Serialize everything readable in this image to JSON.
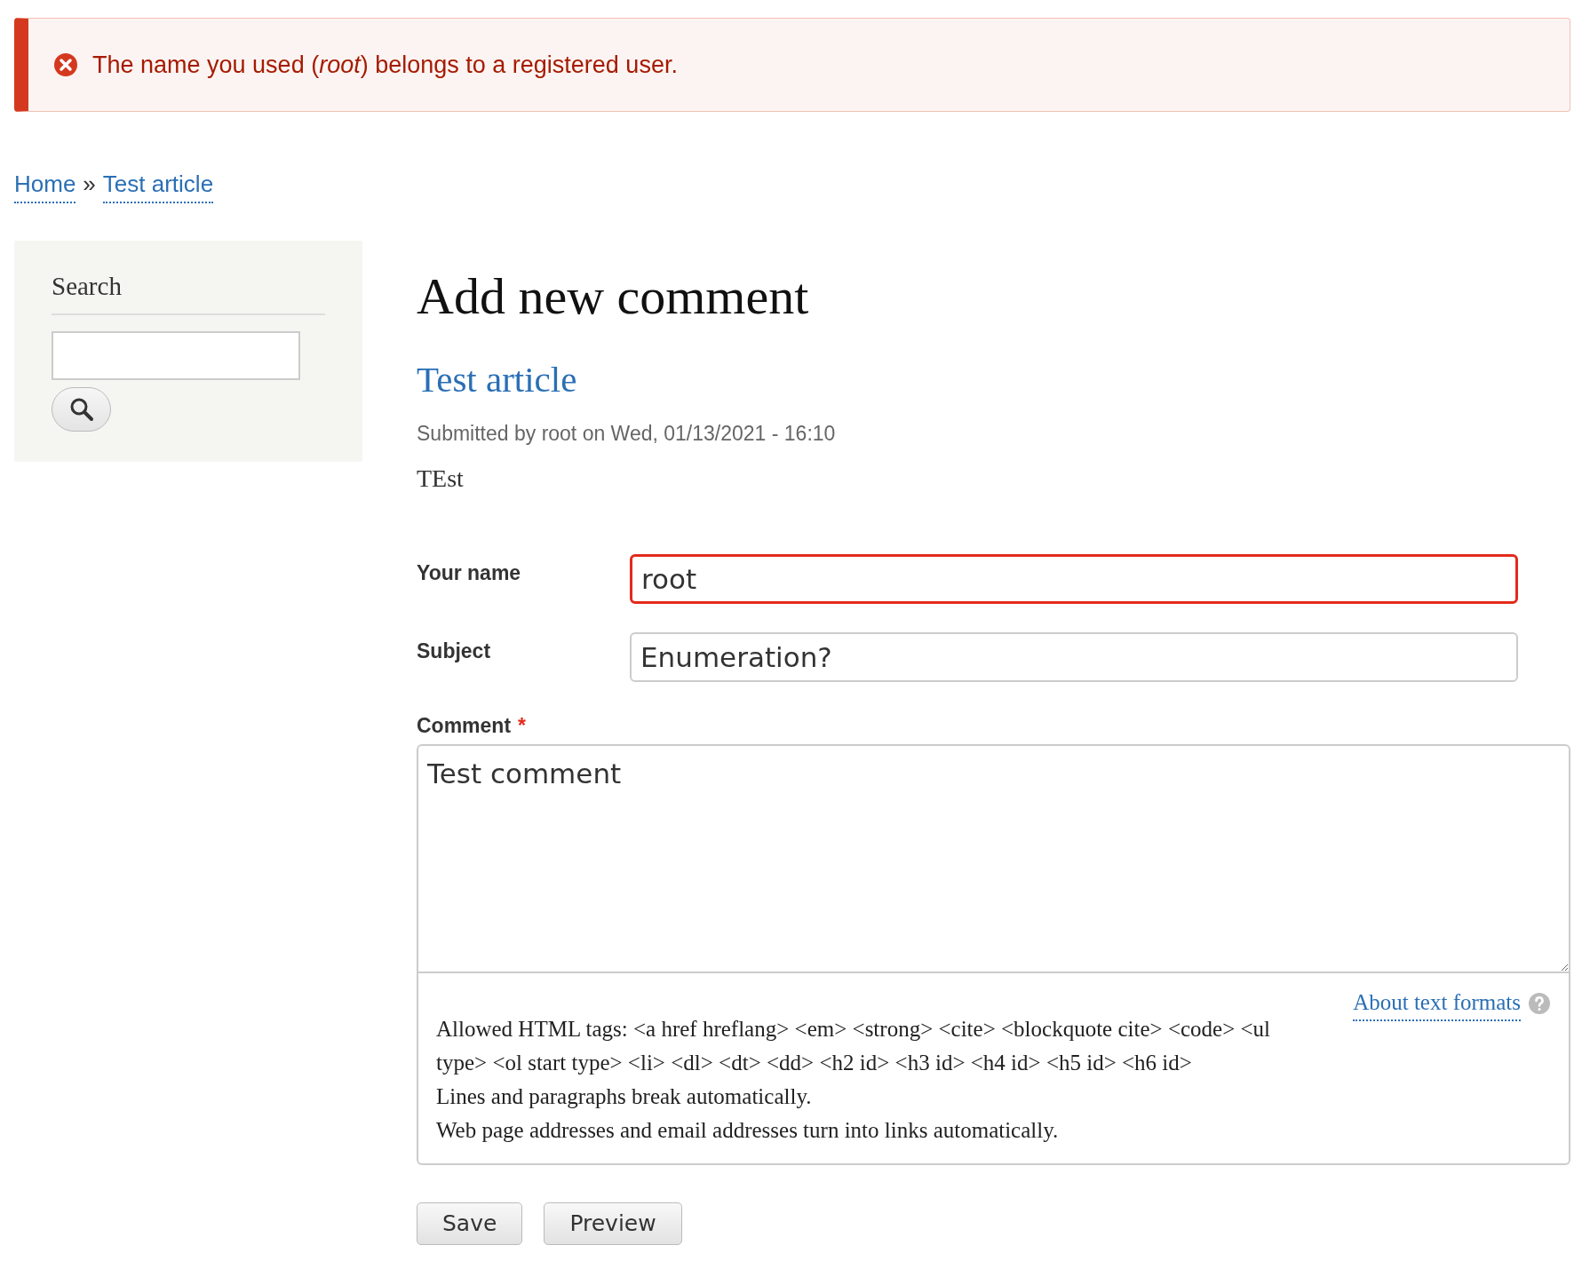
{
  "message": {
    "kind": "error",
    "text": "The name you used (*root*) belongs to a registered user."
  },
  "breadcrumb": [
    {
      "label": "Home"
    },
    {
      "label": "Test article"
    }
  ],
  "breadcrumb_separator": "»",
  "sidebar": {
    "title": "Search"
  },
  "page_title": "Add new comment",
  "article": {
    "title": "Test article",
    "submitted": "Submitted by root on Wed, 01/13/2021 - 16:10",
    "body": "TEst"
  },
  "fields": [
    {
      "kind": "text",
      "label": "Your name",
      "value": "root",
      "error": true
    },
    {
      "kind": "text",
      "label": "Subject",
      "value": "Enumeration?",
      "error": false
    },
    {
      "kind": "textarea",
      "label": "Comment",
      "required_mark": "*",
      "value": "Test comment",
      "error": false
    }
  ],
  "text_format": {
    "link": "About text formats",
    "tips": [
      "Allowed HTML tags: <a href hreflang> <em> <strong> <cite> <blockquote cite> <code> <ul type> <ol start type> <li> <dl> <dt> <dd> <h2 id> <h3 id> <h4 id> <h5 id> <h6 id>",
      "Lines and paragraphs break automatically.",
      "Web page addresses and email addresses turn into links automatically."
    ]
  },
  "buttons": [
    {
      "label": "Save"
    },
    {
      "label": "Preview"
    }
  ]
}
